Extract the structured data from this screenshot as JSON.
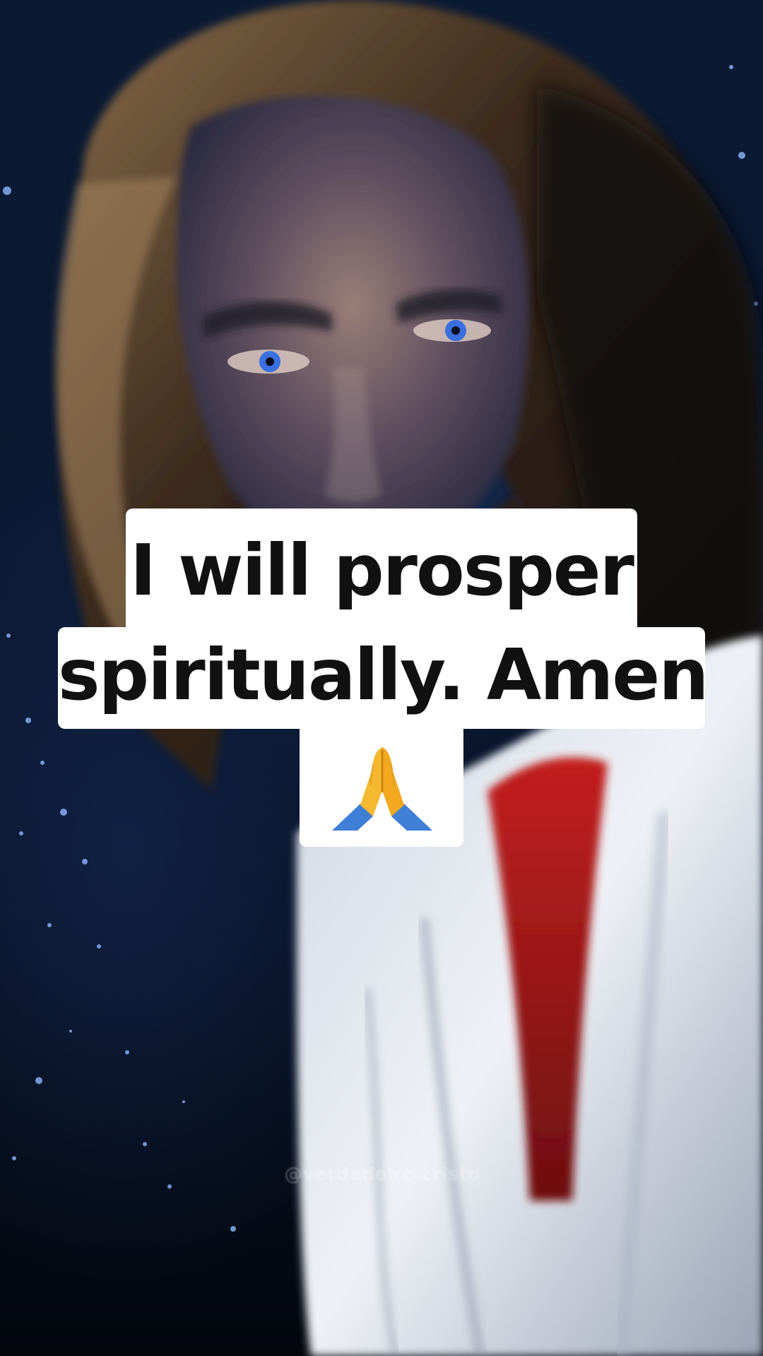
{
  "caption": {
    "line1": "I will prosper",
    "line2": "spiritually. Amen",
    "emoji_icon": "folded-hands-icon"
  },
  "watermark": "@verdadeiro cristo",
  "colors": {
    "caption_bg": "#ffffff",
    "caption_text": "#111111",
    "sky": "#0a1830",
    "robe_white": "#e9edf3",
    "sash_red": "#b1191c",
    "emoji_yellow": "#f6b830",
    "emoji_blue": "#3f7fd6"
  }
}
